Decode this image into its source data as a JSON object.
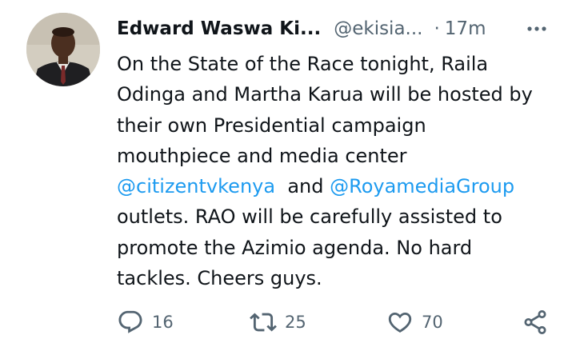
{
  "tweet": {
    "author_name": "Edward Waswa Ki...",
    "handle": "@ekisia...",
    "separator": "·",
    "time": "17m",
    "text_lines": [
      [
        "On the State of the Race tonight, Raila"
      ],
      [
        "Odinga and Martha Karua will be hosted by"
      ],
      [
        "their own Presidential campaign"
      ],
      [
        "mouthpiece and media center"
      ],
      [
        "@citizentvkenya",
        "  and ",
        "@RoyamediaGroup"
      ],
      [
        "outlets. RAO will be carefully assisted to"
      ],
      [
        "promote the Azimio agenda. No hard"
      ],
      [
        "tackles. Cheers guys."
      ]
    ]
  },
  "actions": {
    "reply_count": "16",
    "retweet_count": "25",
    "like_count": "70"
  },
  "icons": {
    "avatar": "avatar-photo",
    "more": "more-icon",
    "reply": "reply-icon",
    "retweet": "retweet-icon",
    "like": "heart-icon",
    "share": "share-icon"
  },
  "colors": {
    "text": "#0f1419",
    "secondary": "#536471",
    "link": "#1d9bf0"
  }
}
